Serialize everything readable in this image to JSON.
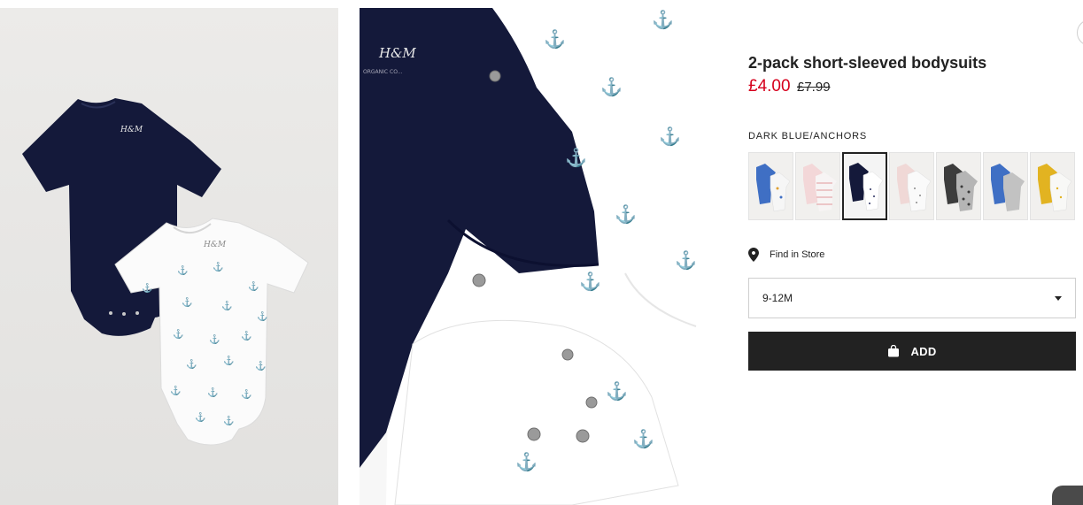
{
  "product": {
    "title": "2-pack short-sleeved bodysuits",
    "price_current": "£4.00",
    "price_original": "£7.99",
    "color_name": "DARK BLUE/ANCHORS",
    "colors": {
      "sale_red": "#d6001c",
      "dark_blue": "#14193a",
      "button_bg": "#222222"
    }
  },
  "image1": {
    "brand_mark": "H&M"
  },
  "image2": {
    "brand_mark": "H&M",
    "label_text": "ORGANIC CO..."
  },
  "swatches": [
    {
      "name": "blue-white",
      "selected": false
    },
    {
      "name": "pink-stripes",
      "selected": false
    },
    {
      "name": "dark-blue-anchors",
      "selected": true
    },
    {
      "name": "pink-white",
      "selected": false
    },
    {
      "name": "dark-grey-hearts",
      "selected": false
    },
    {
      "name": "blue-grey",
      "selected": false
    },
    {
      "name": "yellow-white",
      "selected": false
    }
  ],
  "store": {
    "label": "Find in Store",
    "icon": "location-pin-icon"
  },
  "size_select": {
    "value": "9-12M",
    "icon": "chevron-down-icon"
  },
  "add_button": {
    "label": "ADD",
    "icon": "shopping-bag-icon"
  }
}
